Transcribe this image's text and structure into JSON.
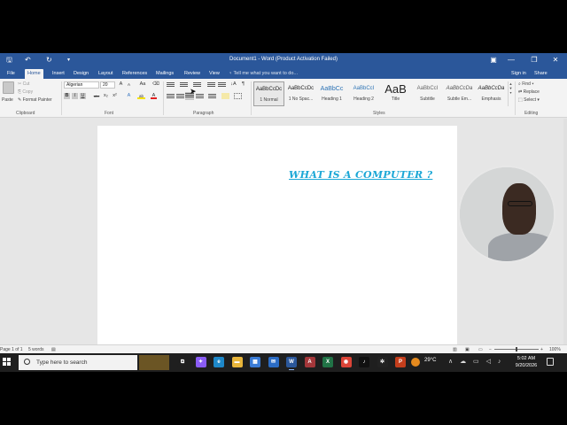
{
  "titlebar": {
    "doc_title": "Document1 - Word (Product Activation Failed)",
    "quick_access": {
      "save": "🖫",
      "undo": "↶",
      "redo": "↻",
      "customize": "▾"
    },
    "window_buttons": {
      "ribbon_options": "▣",
      "minimize": "—",
      "restore": "❐",
      "close": "✕"
    }
  },
  "tabs": [
    {
      "label": "File"
    },
    {
      "label": "Home"
    },
    {
      "label": "Insert"
    },
    {
      "label": "Design"
    },
    {
      "label": "Layout"
    },
    {
      "label": "References"
    },
    {
      "label": "Mailings"
    },
    {
      "label": "Review"
    },
    {
      "label": "View"
    }
  ],
  "tellme": "♀ Tell me what you want to do...",
  "signin": "Sign in",
  "share": "Share",
  "clipboard": {
    "paste": "Paste",
    "cut": "Cut",
    "copy": "Copy",
    "format_painter": "Format Painter",
    "label": "Clipboard"
  },
  "font": {
    "name": "Algerian",
    "size": "20",
    "grow": "A",
    "shrink": "A",
    "case": "Aa",
    "clear": "⌫",
    "bold": "B",
    "italic": "I",
    "underline": "U",
    "strike": "abc",
    "sub": "x₂",
    "sup": "x²",
    "effects": "A",
    "highlight": "ab",
    "color": "A",
    "label": "Font"
  },
  "paragraph": {
    "label": "Paragraph",
    "show_marks": "¶",
    "sort": "↓A"
  },
  "styles": {
    "label": "Styles",
    "items": [
      {
        "preview": "AaBbCcDc",
        "name": "1 Normal"
      },
      {
        "preview": "AaBbCcDc",
        "name": "1 No Spac..."
      },
      {
        "preview": "AaBbCc",
        "name": "Heading 1"
      },
      {
        "preview": "AaBbCcI",
        "name": "Heading 2"
      },
      {
        "preview": "AaB",
        "name": "Title"
      },
      {
        "preview": "AaBbCcI",
        "name": "Subtitle"
      },
      {
        "preview": "AaBbCcDa",
        "name": "Subtle Em..."
      },
      {
        "preview": "AaBbCcDa",
        "name": "Emphasis"
      }
    ]
  },
  "editing": {
    "find": "Find",
    "replace": "Replace",
    "select": "Select",
    "label": "Editing"
  },
  "document": {
    "heading": "WHAT IS A COMPUTER ?"
  },
  "statusbar": {
    "page": "Page 1 of 1",
    "words": "5 words",
    "zoom": "100%"
  },
  "taskbar": {
    "search_placeholder": "Type here to search",
    "apps": [
      {
        "name": "task-view",
        "glyph": "⧉",
        "color": "#1f1f1f"
      },
      {
        "name": "copilot",
        "glyph": "✦",
        "color": "#8a5cf5"
      },
      {
        "name": "edge",
        "glyph": "e",
        "color": "#1e88c9"
      },
      {
        "name": "file-explorer",
        "glyph": "▬",
        "color": "#e8b53a"
      },
      {
        "name": "store",
        "glyph": "▦",
        "color": "#3a7bd5"
      },
      {
        "name": "mail",
        "glyph": "✉",
        "color": "#2b6cc4"
      },
      {
        "name": "word",
        "glyph": "W",
        "color": "#2b579a"
      },
      {
        "name": "access",
        "glyph": "A",
        "color": "#a4373a"
      },
      {
        "name": "excel",
        "glyph": "X",
        "color": "#217346"
      },
      {
        "name": "chrome",
        "glyph": "◉",
        "color": "#db4437"
      },
      {
        "name": "tiktok",
        "glyph": "♪",
        "color": "#111111"
      },
      {
        "name": "chatgpt",
        "glyph": "✲",
        "color": "#222222"
      },
      {
        "name": "powerpoint",
        "glyph": "P",
        "color": "#c43e1c"
      }
    ],
    "weather": "29°C",
    "time": "5:02 AM",
    "date": "9/20/2026"
  }
}
